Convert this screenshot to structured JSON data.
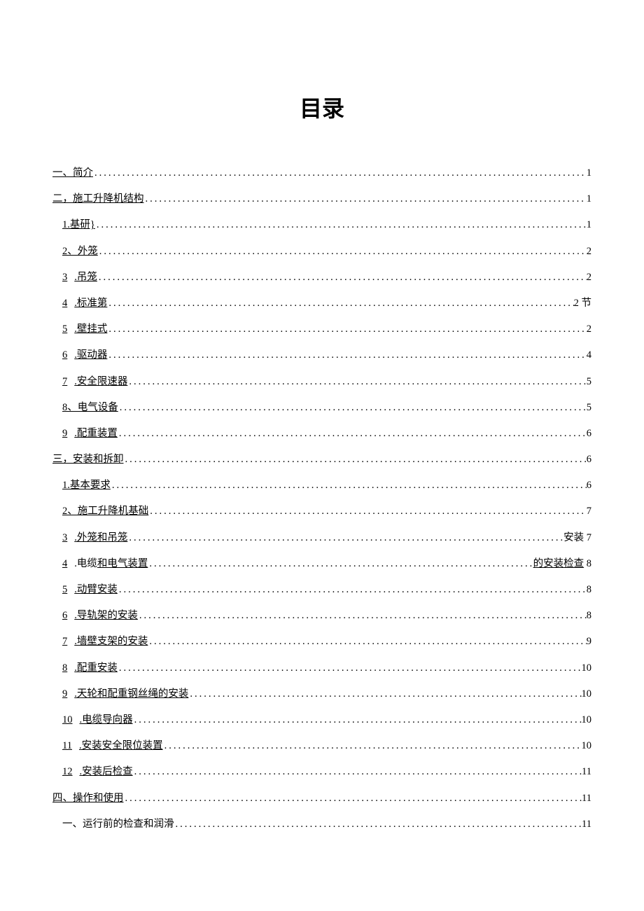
{
  "title": "目录",
  "toc": [
    {
      "level": 1,
      "label": "一、简介",
      "underline": true,
      "suffix": "1"
    },
    {
      "level": 1,
      "label": "二，施工升降机结构",
      "underline": true,
      "suffix": "1"
    },
    {
      "level": 2,
      "num": "",
      "label": "1.基研}",
      "underline": true,
      "suffix": "1"
    },
    {
      "level": 2,
      "num": "",
      "label": "2、外笼",
      "underline": true,
      "suffix": "2"
    },
    {
      "level": 2,
      "num": "3",
      "label": ".吊笼",
      "underline": true,
      "suffix": "2"
    },
    {
      "level": 2,
      "num": "4",
      "label": ".标准第",
      "underline": true,
      "suffix": "2 节"
    },
    {
      "level": 2,
      "num": "5",
      "label": ".壁挂式",
      "underline": true,
      "suffix": "2"
    },
    {
      "level": 2,
      "num": "6",
      "label": ".驱动器",
      "underline": true,
      "suffix": "4"
    },
    {
      "level": 2,
      "num": "7",
      "label": ".安全限速器",
      "underline": true,
      "suffix": "5"
    },
    {
      "level": 2,
      "num": "",
      "label": "8、电气设备",
      "underline": true,
      "suffix": "5"
    },
    {
      "level": 2,
      "num": "9",
      "label": ".配重装置",
      "underline": true,
      "suffix": "6"
    },
    {
      "level": 1,
      "label": "三，安装和拆卸",
      "underline": true,
      "suffix": "6"
    },
    {
      "level": 2,
      "num": "",
      "label": "1.基本要求",
      "underline": true,
      "suffix": "6"
    },
    {
      "level": 2,
      "num": "",
      "label": "2、施工升降机基础",
      "underline": true,
      "suffix": "7"
    },
    {
      "level": 2,
      "num": "3",
      "label": ".外笼和吊笼",
      "underline": true,
      "suffix": "安装 7"
    },
    {
      "level": 2,
      "num": "4",
      "label_pre": ".电缆",
      "label": "和电气装置",
      "underline": true,
      "suffix": "的安装检查 8",
      "suffix_underline_part": "的安装检查"
    },
    {
      "level": 2,
      "num": "5",
      "label": ".动臂安装",
      "underline": true,
      "suffix": "8"
    },
    {
      "level": 2,
      "num": "6",
      "label": ".导轨架的安装",
      "underline": true,
      "suffix": "8"
    },
    {
      "level": 2,
      "num": "7",
      "label": ".墙壁支架的安装",
      "underline": true,
      "suffix": "9"
    },
    {
      "level": 2,
      "num": "8",
      "label": ".配重安装",
      "underline": true,
      "suffix": "10"
    },
    {
      "level": 2,
      "num": "9",
      "label": ".天轮和配重钢丝绳的安装",
      "underline": true,
      "suffix": "10"
    },
    {
      "level": 2,
      "num": "10",
      "label": ".电缆导向器",
      "underline": true,
      "suffix": "10"
    },
    {
      "level": 2,
      "num": "11",
      "label": ".安装安全限位装置",
      "underline": true,
      "suffix": "10"
    },
    {
      "level": 2,
      "num": "12",
      "label": ".安装后检查",
      "underline": true,
      "suffix": "11"
    },
    {
      "level": 1,
      "label": "四、操作和使用",
      "underline": true,
      "suffix": "11"
    },
    {
      "level": 2,
      "num": "",
      "label": "一、运行前的检查和润滑",
      "underline": false,
      "suffix": "11"
    }
  ]
}
